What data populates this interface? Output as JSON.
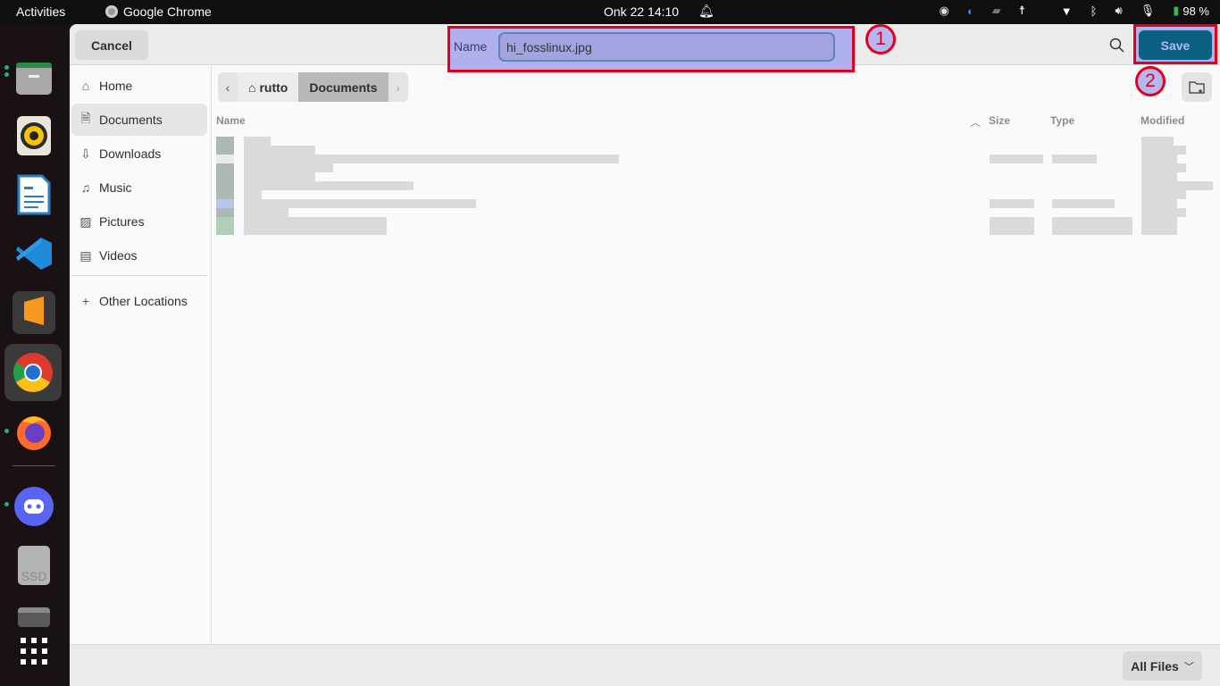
{
  "topbar": {
    "activities": "Activities",
    "app_name": "Google Chrome",
    "clock": "Onk 22  14:10",
    "battery": "98 %",
    "tray_icons": [
      "discord-icon",
      "steam-icon",
      "chat-icon",
      "accessibility-icon",
      "wifi-icon",
      "bluetooth-icon",
      "volume-icon",
      "microphone-icon",
      "battery-icon"
    ]
  },
  "dock": {
    "items": [
      {
        "name": "files",
        "running": true
      },
      {
        "name": "rhythmbox",
        "running": false
      },
      {
        "name": "libreoffice-writer",
        "running": false
      },
      {
        "name": "vscode",
        "running": false
      },
      {
        "name": "sublime-text",
        "running": false
      },
      {
        "name": "google-chrome",
        "running": true,
        "active": true
      },
      {
        "name": "firefox",
        "running": true
      },
      {
        "name": "discord",
        "running": true
      },
      {
        "name": "ssd-drive",
        "running": false
      },
      {
        "name": "removable-drive",
        "running": false
      },
      {
        "name": "show-applications",
        "running": false
      }
    ],
    "ssd_label": "SSD"
  },
  "dialog": {
    "cancel_label": "Cancel",
    "name_label": "Name",
    "filename_value": "hi_fosslinux.jpg",
    "save_label": "Save",
    "annotations": [
      "1",
      "2"
    ],
    "sidebar": [
      {
        "label": "Home",
        "icon": "home-icon"
      },
      {
        "label": "Documents",
        "icon": "document-icon",
        "active": true
      },
      {
        "label": "Downloads",
        "icon": "download-icon"
      },
      {
        "label": "Music",
        "icon": "music-icon"
      },
      {
        "label": "Pictures",
        "icon": "pictures-icon"
      },
      {
        "label": "Videos",
        "icon": "video-icon"
      },
      {
        "label": "Other Locations",
        "icon": "plus-icon"
      }
    ],
    "pathbar": {
      "home": "rutto",
      "current": "Documents"
    },
    "columns": {
      "name": "Name",
      "size": "Size",
      "type": "Type",
      "modified": "Modified"
    },
    "file_filter": "All Files"
  }
}
